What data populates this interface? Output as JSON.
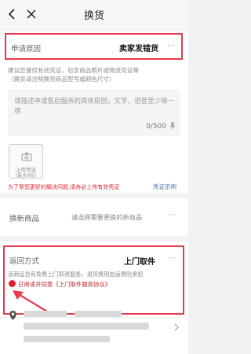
{
  "nav": {
    "title": "换货"
  },
  "reason": {
    "label": "申请原因",
    "value": "卖家发错货",
    "more": "···",
    "hint_line1": "建议您提供有效凭证，包含商品照片或物流凭证等",
    "hint_line2": "（换货请注明换货商品型号或颜色尺寸）",
    "textarea_placeholder": "请描述申请售后服务的具体原因，文字、语音至少填一项",
    "counter": "0/500",
    "upload_label": "上传凭证",
    "upload_sub": "(最多9张)",
    "red_tip": "为了帮您更好的解决问题,请务必上传有效凭证",
    "example_link": "凭证示例"
  },
  "new_goods": {
    "label": "换新商品",
    "placeholder": "请选择需要更换的新商品",
    "more": "···"
  },
  "return_method": {
    "label": "返回方式",
    "value": "上门取件",
    "more": "···",
    "desc": "该商品含有免费上门取退服务，退货费用由运费险承担",
    "agree_text": "已阅读并同意《上门取件服务协议》"
  },
  "colors": {
    "accent_red": "#e63a4d",
    "link_blue": "#4a6ea9"
  },
  "icons": [
    "back-icon",
    "close-icon",
    "microphone-icon",
    "camera-icon",
    "location-pin-icon",
    "check-icon",
    "arrow-annotation"
  ]
}
